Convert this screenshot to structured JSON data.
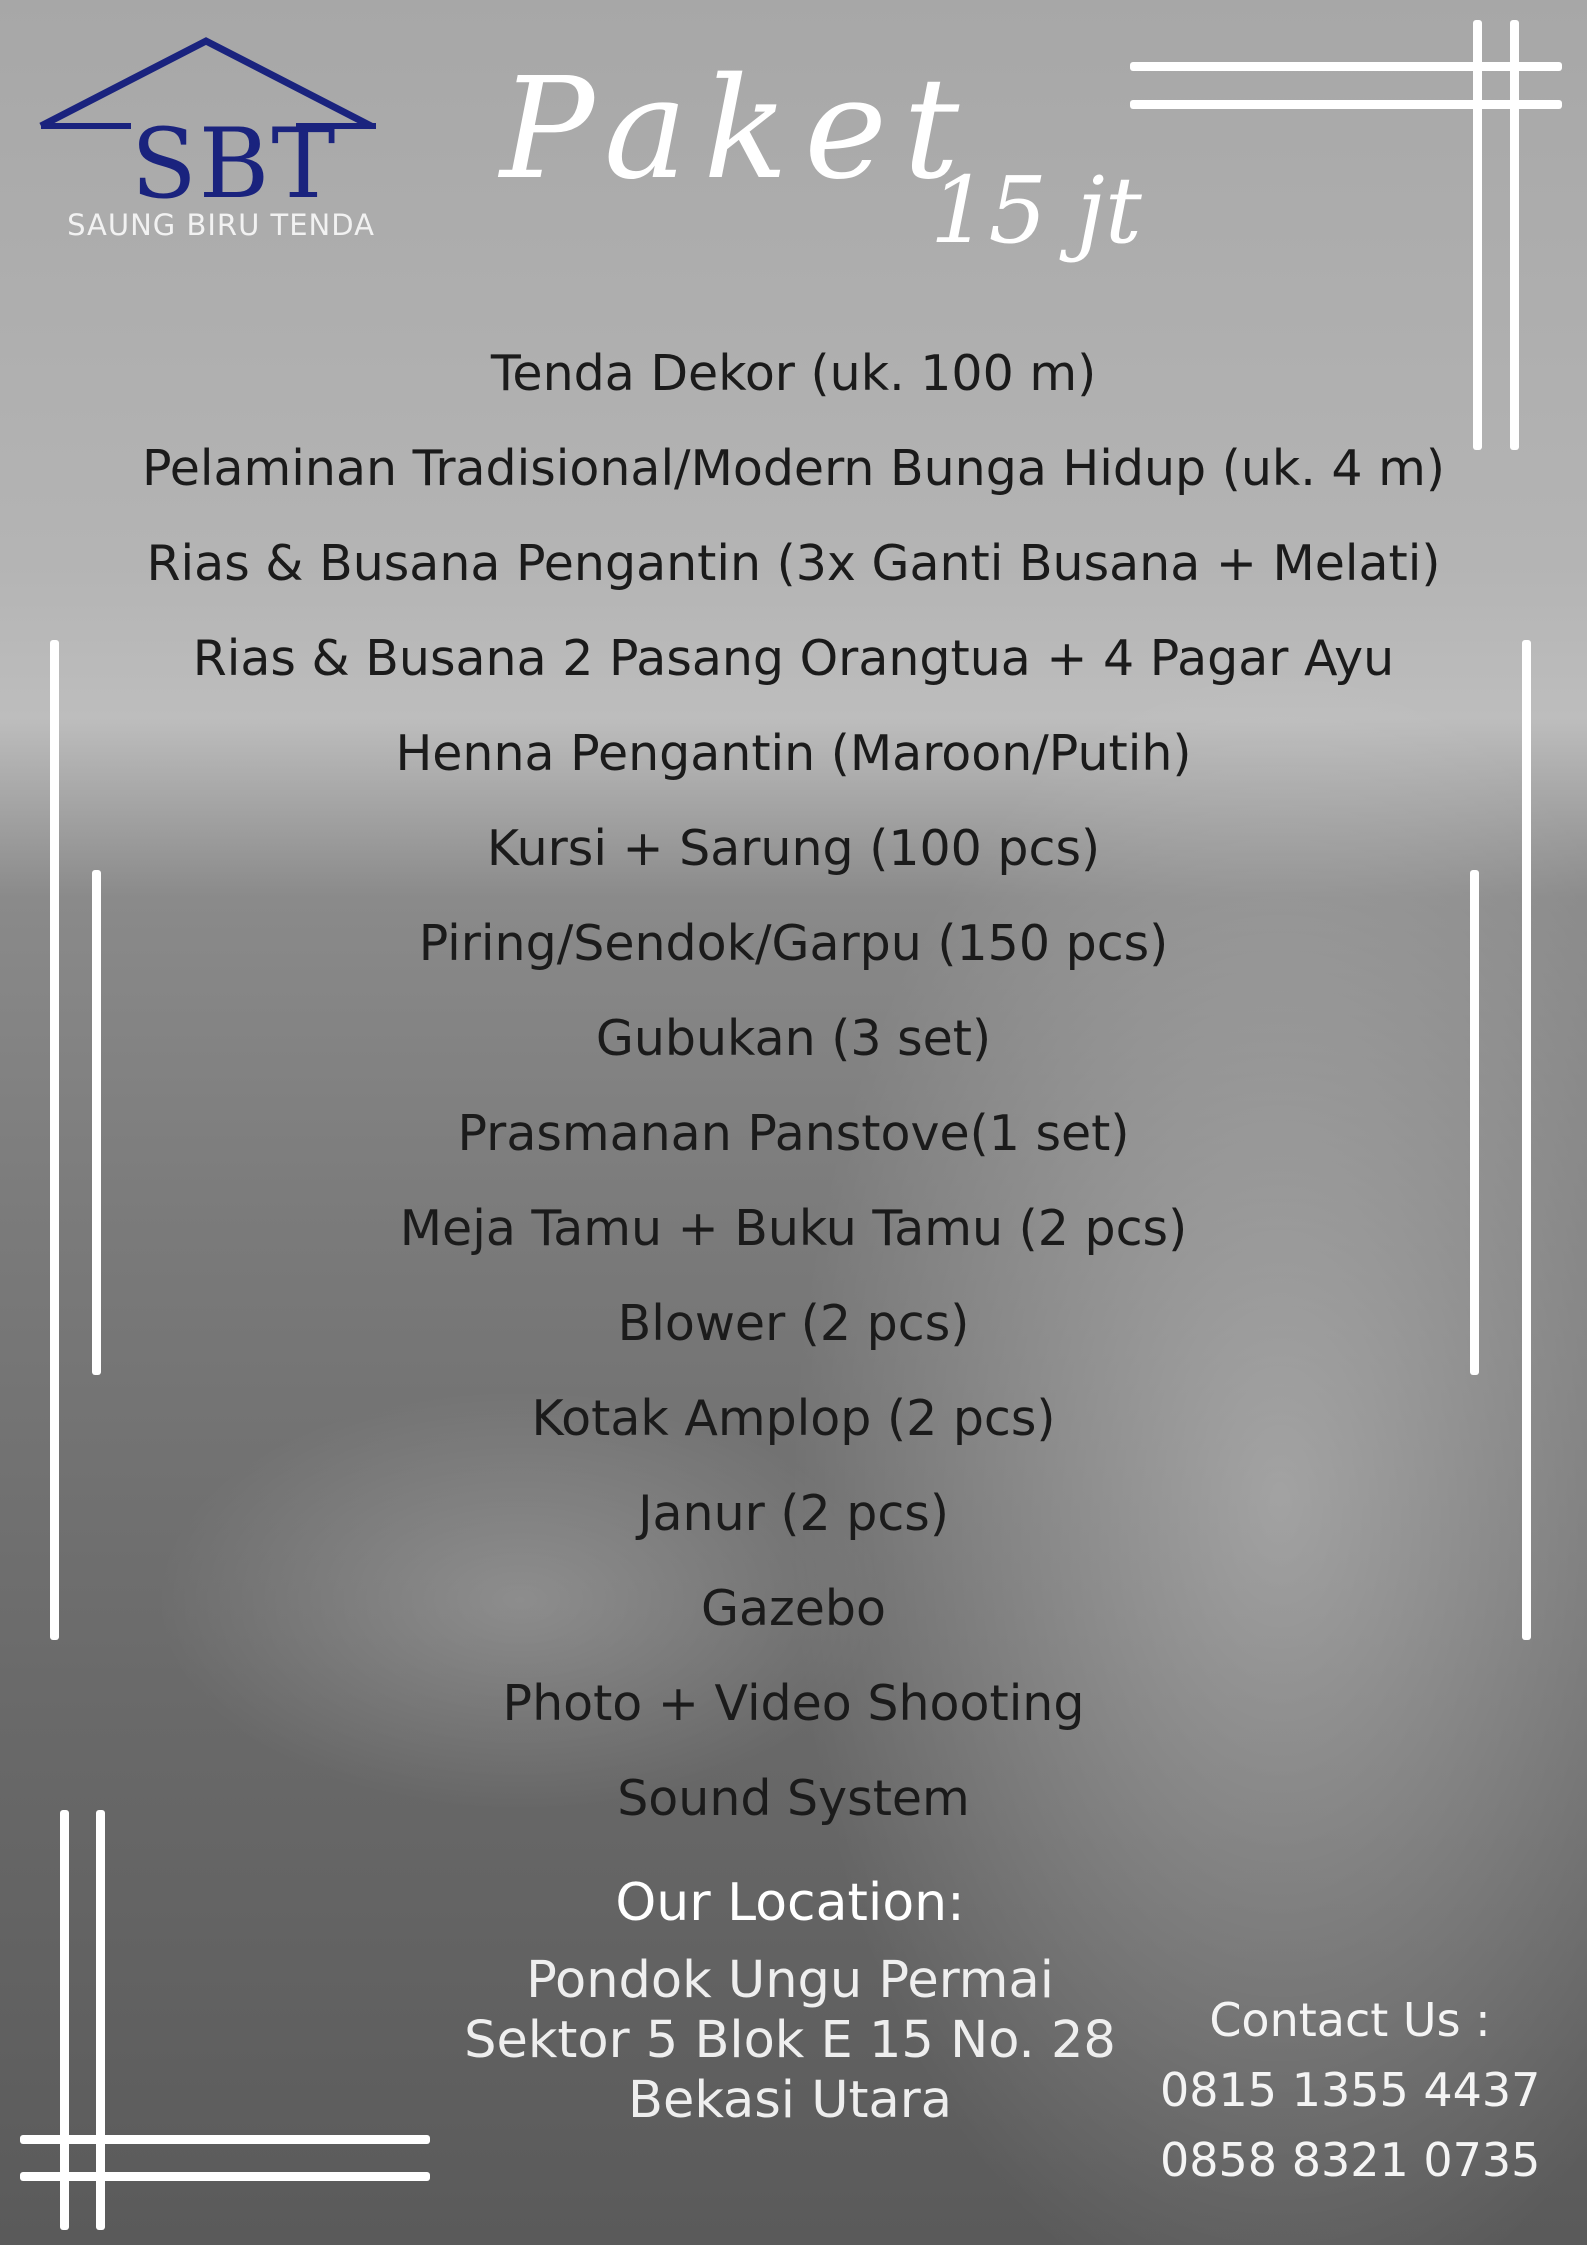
{
  "logo": {
    "letters": "SBT",
    "name": "SAUNG BIRU TENDA",
    "color": "#1a237e"
  },
  "header": {
    "title": "Paket",
    "subtitle": "15 jt"
  },
  "items": [
    "Tenda Dekor (uk. 100 m)",
    "Pelaminan Tradisional/Modern Bunga Hidup (uk. 4 m)",
    "Rias & Busana Pengantin (3x Ganti Busana + Melati)",
    "Rias & Busana  2 Pasang  Orangtua + 4 Pagar Ayu",
    "Henna Pengantin (Maroon/Putih)",
    "Kursi + Sarung (100 pcs)",
    "Piring/Sendok/Garpu (150 pcs)",
    "Gubukan (3 set)",
    "Prasmanan Panstove(1 set)",
    "Meja Tamu + Buku Tamu (2 pcs)",
    "Blower (2 pcs)",
    "Kotak Amplop (2 pcs)",
    "Janur (2 pcs)",
    "Gazebo",
    "Photo + Video Shooting",
    "Sound System"
  ],
  "location": {
    "label": "Our Location:",
    "lines": [
      "Pondok Ungu Permai",
      "Sektor 5 Blok E 15 No. 28",
      "Bekasi Utara"
    ]
  },
  "contact": {
    "label": "Contact Us :",
    "phones": [
      "0815 1355 4437",
      "0858 8321 0735"
    ]
  }
}
